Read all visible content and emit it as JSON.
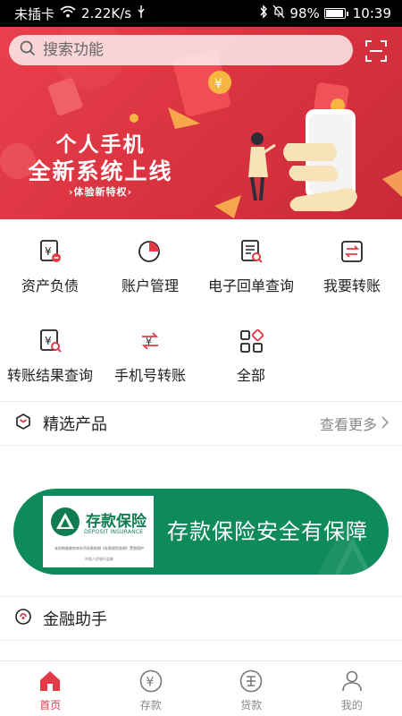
{
  "status_bar": {
    "carrier": "未插卡",
    "network_speed": "2.22K/s",
    "battery": "98%",
    "battery_level": 0.98,
    "time": "10:39"
  },
  "search": {
    "placeholder": "搜索功能"
  },
  "banner": {
    "title_line1": "个人手机",
    "title_line2": "全新系统上线",
    "cta": "›体验新特权›"
  },
  "functions": [
    {
      "label": "资产负债",
      "icon": "asset-liability-icon"
    },
    {
      "label": "账户管理",
      "icon": "pie-chart-icon"
    },
    {
      "label": "电子回单查询",
      "icon": "receipt-search-icon"
    },
    {
      "label": "我要转账",
      "icon": "transfer-icon"
    },
    {
      "label": "转账结果查询",
      "icon": "transfer-result-icon"
    },
    {
      "label": "手机号转账",
      "icon": "phone-transfer-icon"
    },
    {
      "label": "全部",
      "icon": "all-grid-icon"
    }
  ],
  "featured": {
    "title": "精选产品",
    "more": "查看更多"
  },
  "insurance": {
    "card_title": "存款保险",
    "card_subtitle": "DEPOSIT INSURANCE",
    "card_line1": "本机构吸收的本外币存款依照《存款保险条例》受到保护",
    "card_line2": "中国人民银行监制",
    "slogan": "存款保险安全有保障"
  },
  "assistant": {
    "title": "金融助手"
  },
  "nav": [
    {
      "label": "首页",
      "active": true
    },
    {
      "label": "存款",
      "active": false
    },
    {
      "label": "贷款",
      "active": false
    },
    {
      "label": "我的",
      "active": false
    }
  ],
  "colors": {
    "brand_red": "#e23a47",
    "insurance_green": "#0f8a5c"
  }
}
